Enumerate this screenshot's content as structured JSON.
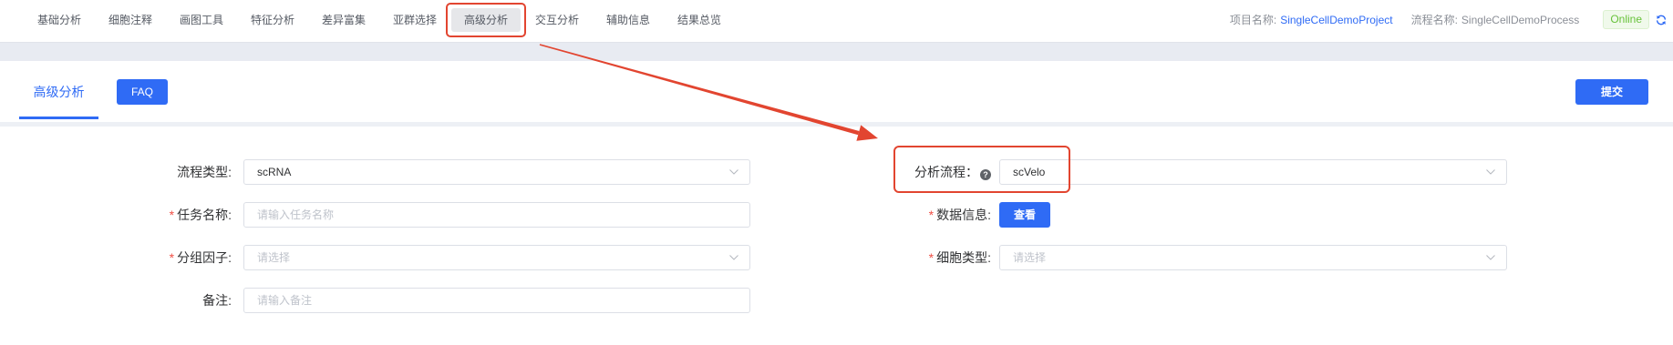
{
  "nav": {
    "items": [
      {
        "label": "基础分析"
      },
      {
        "label": "细胞注释"
      },
      {
        "label": "画图工具"
      },
      {
        "label": "特征分析"
      },
      {
        "label": "差异富集"
      },
      {
        "label": "亚群选择"
      },
      {
        "label": "高级分析"
      },
      {
        "label": "交互分析"
      },
      {
        "label": "辅助信息"
      },
      {
        "label": "结果总览"
      }
    ],
    "active_index": 6
  },
  "header": {
    "project_label": "项目名称:",
    "project_name": "SingleCellDemoProject",
    "process_label": "流程名称:",
    "process_name": "SingleCellDemoProcess",
    "status": "Online"
  },
  "panel": {
    "active_tab": "高级分析",
    "faq_button": "FAQ",
    "submit_button": "提交"
  },
  "form": {
    "required_mark": "*",
    "workflow_type": {
      "label": "流程类型:",
      "value": "scRNA",
      "required": false
    },
    "task_name": {
      "label": "任务名称:",
      "placeholder": "请输入任务名称",
      "required": true
    },
    "group_factor": {
      "label": "分组因子:",
      "placeholder": "请选择",
      "required": true
    },
    "remark": {
      "label": "备注:",
      "placeholder": "请输入备注",
      "required": false
    },
    "analysis_pipeline": {
      "label": "分析流程：",
      "value": "scVelo",
      "help_mark": "?",
      "required": false
    },
    "data_info": {
      "label": "数据信息:",
      "button": "查看",
      "required": true
    },
    "cell_type": {
      "label": "细胞类型:",
      "placeholder": "请选择",
      "required": true
    }
  },
  "icons": {
    "select_arrow": "chevron-down-icon",
    "help": "question-circle-icon",
    "refresh": "refresh-icon"
  },
  "colors": {
    "accent": "#2f6bf5",
    "online": "#67c23a",
    "required": "#f04f45",
    "annotation": "#e24530"
  }
}
